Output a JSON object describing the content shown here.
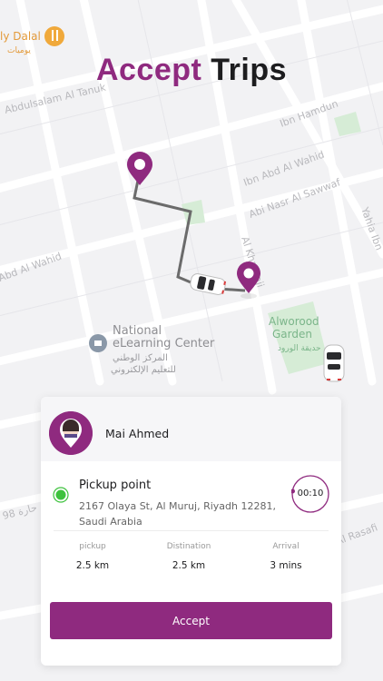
{
  "headline": {
    "accent": "Accept",
    "rest": "Trips"
  },
  "map": {
    "poi_restaurant_en": "ly Dalal",
    "poi_restaurant_ar": "يوميات",
    "street_abdulsalam": "Abdulsalam Al Tanuk",
    "street_ibn_hamdun": "Ibn Hamdun",
    "street_ibn_abd_al_wahid": "Ibn Abd Al Wahid",
    "street_abi_nasr": "Abi Nasr Al Sawwaf",
    "street_yahia": "Yahia Ibn",
    "street_al_khazraji": "Al Khazraji",
    "street_abd_al_wahid": "Abd Al Wahid",
    "poi_center_line1": "National",
    "poi_center_line2": "eLearning Center",
    "poi_center_ar1": "المركز الوطني",
    "poi_center_ar2": "للتعليم الإلكتروني",
    "park_line1": "Alworood",
    "park_line2": "Garden",
    "park_ar": "حديقة الورود",
    "street_bottom_left": "حارة 98",
    "street_right": "Al Rasafi"
  },
  "trip": {
    "driver_name": "Mai Ahmed",
    "pickup_title": "Pickup point",
    "pickup_address": "2167 Olaya St, Al Muruj, Riyadh 12281, Saudi Arabia",
    "timer": "00:10",
    "stats": [
      {
        "label": "pickup",
        "value": "2.5 km"
      },
      {
        "label": "Distination",
        "value": "2.5 km"
      },
      {
        "label": "Arrival",
        "value": "3 mins"
      }
    ],
    "accept_label": "Accept"
  },
  "colors": {
    "brand": "#8f2a7f",
    "status_dot": "#3ec23e",
    "map_bg": "#f2f2f4",
    "park": "#d6ecd6"
  }
}
